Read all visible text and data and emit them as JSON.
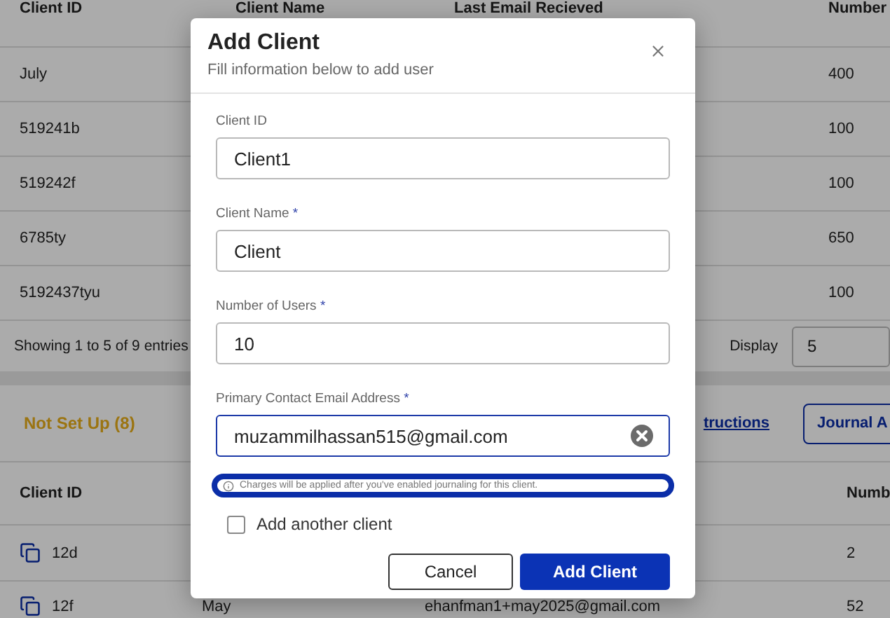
{
  "background": {
    "top_table": {
      "columns": [
        "Client ID",
        "Client Name",
        "Last Email Recieved",
        "Number"
      ],
      "rows": [
        {
          "client_id": "July",
          "number": "400"
        },
        {
          "client_id": "519241b",
          "number": "100"
        },
        {
          "client_id": "519242f",
          "number": "100"
        },
        {
          "client_id": "6785ty",
          "number": "650"
        },
        {
          "client_id": "5192437tyu",
          "number": "100"
        }
      ]
    },
    "pagination": {
      "summary": "Showing 1 to 5 of 9 entries",
      "display_label": "Display",
      "display_value": "5"
    },
    "section": {
      "title": "Not Set Up (8)",
      "link": "tructions",
      "button": "Journal A"
    },
    "bottom_table": {
      "columns": [
        "Client ID",
        "Numb"
      ],
      "rows": [
        {
          "client_id": "12d",
          "number": "2"
        },
        {
          "client_id": "12f",
          "client_name": "May",
          "email": "ehanfman1+may2025@gmail.com",
          "number": "52"
        }
      ]
    }
  },
  "modal": {
    "title": "Add Client",
    "subtitle": "Fill information below to add user",
    "fields": [
      {
        "label": "Client ID",
        "value": "Client1",
        "focused": false,
        "clearable": false
      },
      {
        "label": "Client Name",
        "required_mark": "*",
        "value": "Client",
        "focused": false,
        "clearable": false
      },
      {
        "label": "Number of Users",
        "required_mark": "*",
        "value": "10",
        "focused": false,
        "clearable": false
      },
      {
        "label": "Primary Contact Email Address",
        "required_mark": "*",
        "value": "muzammilhassan515@gmail.com",
        "focused": true,
        "clearable": true
      }
    ],
    "note": {
      "text": "Charges will be applied after you've enabled journaling for this client.",
      "highlighted": true
    },
    "checkbox": {
      "label": "Add another client",
      "checked": false
    },
    "buttons": {
      "cancel": "Cancel",
      "submit": "Add Client"
    }
  }
}
